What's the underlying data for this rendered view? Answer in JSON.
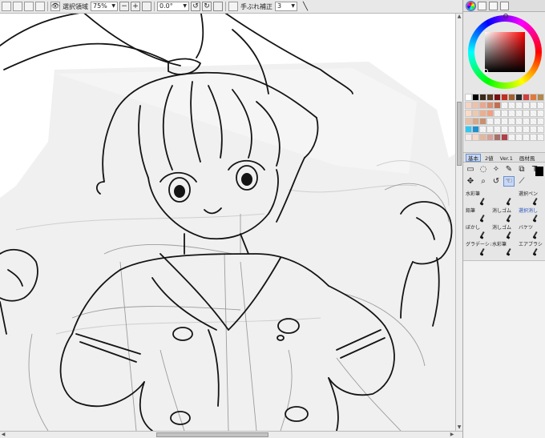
{
  "toolbar": {
    "selection_label": "選択領域",
    "zoom_value": "75%",
    "rotation_value": "0.0°",
    "stabilizer_label": "手ぶれ補正",
    "stabilizer_value": "3",
    "zoom_minus": "−",
    "zoom_plus": "+",
    "zoom_reset": "",
    "rotate_ccw": "↺",
    "rotate_cw": "↻",
    "rotate_reset": "",
    "pen_pressure": "╲"
  },
  "colors": {
    "current_color": "#c8102e",
    "canvas_background": "#ffffff",
    "panel_background": "#e6e6e6",
    "accent": "#3a6fd8"
  },
  "panel": {
    "tab_icons": [
      "color-wheel-icon",
      "rgb-slider-icon",
      "hsv-slider-icon",
      "swatch-icon"
    ],
    "swatch_rows": [
      [
        "#ffffff",
        "#000000",
        "#3a2a18",
        "#5a3a20",
        "#7a1010",
        "#c03020",
        "#a06030",
        "#2a2a2a",
        "#d04040",
        "#e07a3a",
        "#b08850"
      ],
      [
        "#f4d4c4",
        "#f0c0a8",
        "#e8a890",
        "#d89070",
        "#c07050",
        "",
        "",
        "",
        "",
        "",
        ""
      ],
      [
        "#f8dcc8",
        "#f0c8b0",
        "#e8b090",
        "#f0a080",
        "",
        "",
        "",
        "",
        "",
        "",
        ""
      ],
      [
        "#e8c0a8",
        "#d8a888",
        "#c89070",
        "",
        "",
        "",
        "",
        "",
        "",
        "",
        ""
      ],
      [
        "#30c8f0",
        "#2090d0",
        "",
        "",
        "",
        "",
        "",
        "",
        "",
        "",
        ""
      ],
      [
        "#f4e8e8",
        "#f8d8c8",
        "#e0b8a0",
        "#d8a098",
        "#a87068",
        "#b04048",
        "",
        "",
        "",
        "",
        ""
      ]
    ],
    "tool_tabs": [
      {
        "label": "基本",
        "active": true
      },
      {
        "label": "2値",
        "active": false
      },
      {
        "label": "Ver.1",
        "active": false
      },
      {
        "label": "画材風",
        "active": false
      }
    ],
    "tools": [
      {
        "name": "rect-select-icon",
        "glyph": "▭"
      },
      {
        "name": "lasso-select-icon",
        "glyph": "◌"
      },
      {
        "name": "magic-wand-icon",
        "glyph": "✧"
      },
      {
        "name": "select-pen-icon",
        "glyph": "✎"
      },
      {
        "name": "layer-select-icon",
        "glyph": "⧉"
      },
      {
        "name": "text-tool-icon",
        "glyph": "T"
      },
      {
        "name": "move-icon",
        "glyph": "✥"
      },
      {
        "name": "zoom-icon",
        "glyph": "⌕"
      },
      {
        "name": "rotate-view-icon",
        "glyph": "↺"
      },
      {
        "name": "hand-icon",
        "glyph": "☜"
      },
      {
        "name": "eyedropper-icon",
        "glyph": "⟋"
      },
      {
        "name": "none-icon",
        "glyph": ""
      }
    ],
    "brushes": [
      {
        "label": "水彩筆",
        "highlight": false
      },
      {
        "label": "",
        "highlight": false
      },
      {
        "label": "選択ペン",
        "highlight": false
      },
      {
        "label": "鉛筆",
        "highlight": false
      },
      {
        "label": "消しゴム",
        "highlight": false
      },
      {
        "label": "選択消し",
        "highlight": true
      },
      {
        "label": "ぼかし",
        "highlight": false
      },
      {
        "label": "消しゴム",
        "highlight": false
      },
      {
        "label": "バケツ",
        "highlight": false
      },
      {
        "label": "グラデーション",
        "highlight": false
      },
      {
        "label": "水彩筆",
        "highlight": false
      },
      {
        "label": "エアブラシ",
        "highlight": false
      }
    ]
  }
}
